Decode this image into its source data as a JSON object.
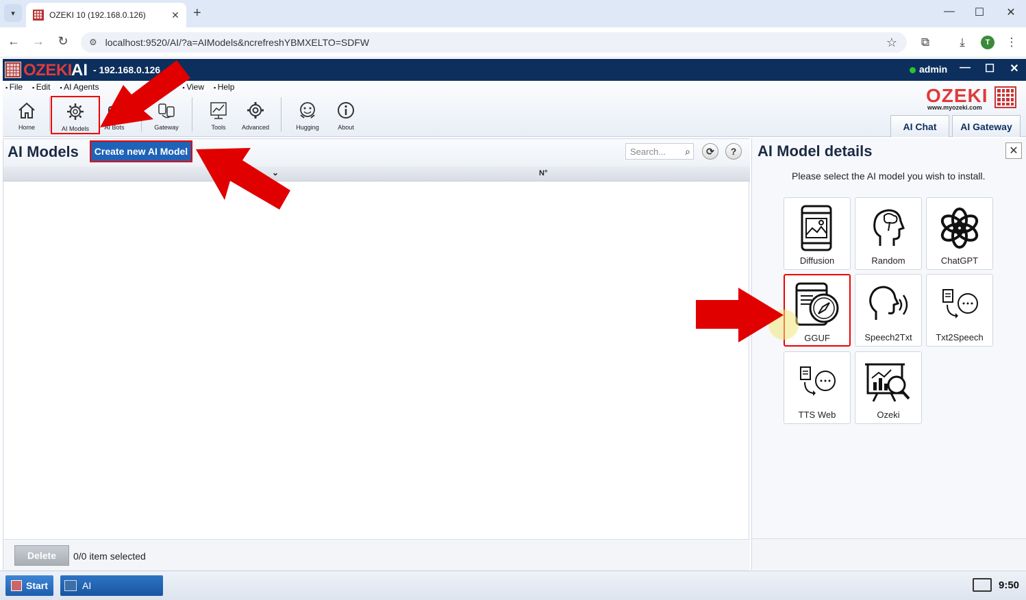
{
  "browser": {
    "tab_title": "OZEKI 10 (192.168.0.126)",
    "url": "localhost:9520/AI/?a=AIModels&ncrefreshYBMXELTO=SDFW",
    "profile_initial": "T"
  },
  "app": {
    "brand": "OZEKI",
    "product": "AI",
    "host": "- 192.168.0.126",
    "user": "admin",
    "right_logo_text": "OZEKI",
    "right_logo_sub": "www.myozeki.com"
  },
  "menu": [
    "File",
    "Edit",
    "AI Agents",
    "View",
    "Help"
  ],
  "toolbar": {
    "home": "Home",
    "ai_models": "AI Models",
    "ai_bots": "AI Bots",
    "gateway": "Gateway",
    "tools": "Tools",
    "advanced": "Advanced",
    "hugging": "Hugging",
    "about": "About"
  },
  "right_tabs": {
    "ai_chat": "AI Chat",
    "ai_gateway": "AI Gateway"
  },
  "left_panel": {
    "title": "AI Models",
    "create_button": "Create new AI Model",
    "search_placeholder": "Search...",
    "column_num": "N°",
    "delete_button": "Delete",
    "selection_status": "0/0 item selected"
  },
  "right_panel": {
    "title": "AI Model details",
    "hint": "Please select the AI model you wish to install.",
    "cards": [
      {
        "label": "Diffusion"
      },
      {
        "label": "Random"
      },
      {
        "label": "ChatGPT"
      },
      {
        "label": "GGUF"
      },
      {
        "label": "Speech2Txt"
      },
      {
        "label": "Txt2Speech"
      },
      {
        "label": "TTS Web"
      },
      {
        "label": "Ozeki"
      }
    ]
  },
  "taskbar": {
    "start": "Start",
    "app_item": "AI",
    "clock": "9:50"
  },
  "accent_colors": {
    "title_bar": "#0c2f5d",
    "brand_red": "#e03a3a",
    "button_blue": "#1f63b8",
    "highlight_red": "#e00000"
  }
}
